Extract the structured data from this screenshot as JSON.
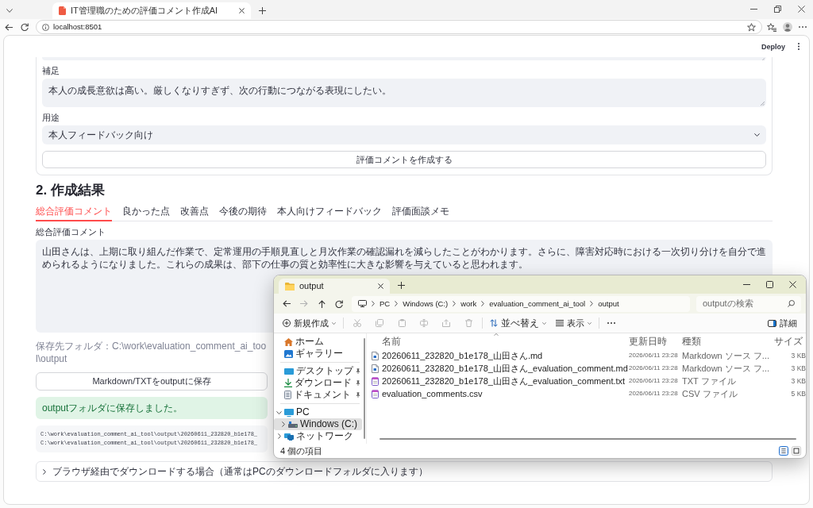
{
  "browser": {
    "tab_title": "IT管理職のための評価コメント作成AI",
    "address": "localhost:8501"
  },
  "app": {
    "deploy_button": "Deploy",
    "form": {
      "fields": [
        {
          "kind": "textarea",
          "label": "補足",
          "value": "本人の成長意欲は高い。厳しくなりすぎず、次の行動につながる表現にしたい。"
        },
        {
          "kind": "select",
          "label": "用途",
          "value": "本人フィードバック向け"
        }
      ],
      "submit_button": "評価コメントを作成する"
    },
    "results": {
      "heading": "2. 作成結果",
      "tabs": [
        {
          "label": "総合評価コメント",
          "selected": true
        },
        {
          "label": "良かった点",
          "selected": false
        },
        {
          "label": "改善点",
          "selected": false
        },
        {
          "label": "今後の期待",
          "selected": false
        },
        {
          "label": "本人向けフィードバック",
          "selected": false
        },
        {
          "label": "評価面談メモ",
          "selected": false
        }
      ],
      "comment": {
        "label": "総合評価コメント",
        "value": "山田さんは、上期に取り組んだ作業で、定常運用の手順見直しと月次作業の確認漏れを減らしたことがわかります。さらに、障害対応時における一次切り分けを自分で進められるようになりました。これらの成果は、部下の仕事の質と効率性に大きな影響を与えていると思われます。"
      },
      "save_folder": "保存先フォルダ：C:\\work\\evaluation_comment_ai_tool\\output",
      "save_button": "Markdown/TXTをoutputに保存",
      "success_message": "outputフォルダに保存しました。",
      "saved_paths": [
        "C:\\work\\evaluation_comment_ai_tool\\output\\20260611_232820_b1e178_",
        "C:\\work\\evaluation_comment_ai_tool\\output\\20260611_232820_b1e178_"
      ],
      "download_expander": {
        "label": "ブラウザ経由でダウンロードする場合（通常はPCのダウンロードフォルダに入ります）",
        "expanded": false
      }
    }
  },
  "explorer": {
    "tab_title": "output",
    "nav_buttons": [
      {
        "disabled": false
      },
      {
        "disabled": true
      },
      {
        "disabled": false
      },
      {
        "disabled": false
      }
    ],
    "breadcrumb": [
      "PC",
      "Windows (C:)",
      "work",
      "evaluation_comment_ai_tool",
      "output"
    ],
    "search": {
      "placeholder": "outputの検索"
    },
    "toolbar": {
      "new": "新規作成",
      "tools": [
        {
          "disabled": true
        },
        {
          "disabled": true
        },
        {
          "disabled": true
        },
        {
          "disabled": true
        },
        {
          "disabled": true
        },
        {
          "disabled": true
        }
      ],
      "sort": "並べ替え",
      "view": "表示",
      "details": "詳細"
    },
    "nav_sections": [
      {
        "items": [
          {
            "label": "ホーム",
            "selected": false,
            "pinned": false
          },
          {
            "label": "ギャラリー",
            "selected": false,
            "pinned": false
          }
        ]
      },
      {
        "items": [
          {
            "label": "デスクトップ",
            "selected": false,
            "pinned": true
          },
          {
            "label": "ダウンロード",
            "selected": false,
            "pinned": true
          },
          {
            "label": "ドキュメント",
            "selected": false,
            "pinned": true
          }
        ]
      },
      {
        "items": [
          {
            "label": "PC",
            "selected": false,
            "expanded": true,
            "children": [
              {
                "label": "Windows (C:)",
                "selected": true,
                "expanded": false
              }
            ]
          },
          {
            "label": "ネットワーク",
            "selected": false,
            "expanded": false
          }
        ]
      }
    ],
    "columns": [
      "名前",
      "更新日時",
      "種類",
      "サイズ"
    ],
    "files": [
      {
        "kind": "md",
        "name": "20260611_232820_b1e178_山田さん.md",
        "modified": "2026/06/11 23:28",
        "type": "Markdown ソース フ...",
        "size": "3 KB"
      },
      {
        "kind": "md",
        "name": "20260611_232820_b1e178_山田さん_evaluation_comment.md",
        "modified": "2026/06/11 23:28",
        "type": "Markdown ソース フ...",
        "size": "3 KB"
      },
      {
        "kind": "txt",
        "name": "20260611_232820_b1e178_山田さん_evaluation_comment.txt",
        "modified": "2026/06/11 23:28",
        "type": "TXT ファイル",
        "size": "3 KB"
      },
      {
        "kind": "csv",
        "name": "evaluation_comments.csv",
        "modified": "2026/06/11 23:28",
        "type": "CSV ファイル",
        "size": "5 KB"
      }
    ],
    "status": "4 個の項目",
    "views": [
      {
        "selected": true
      },
      {
        "selected": false
      }
    ]
  }
}
